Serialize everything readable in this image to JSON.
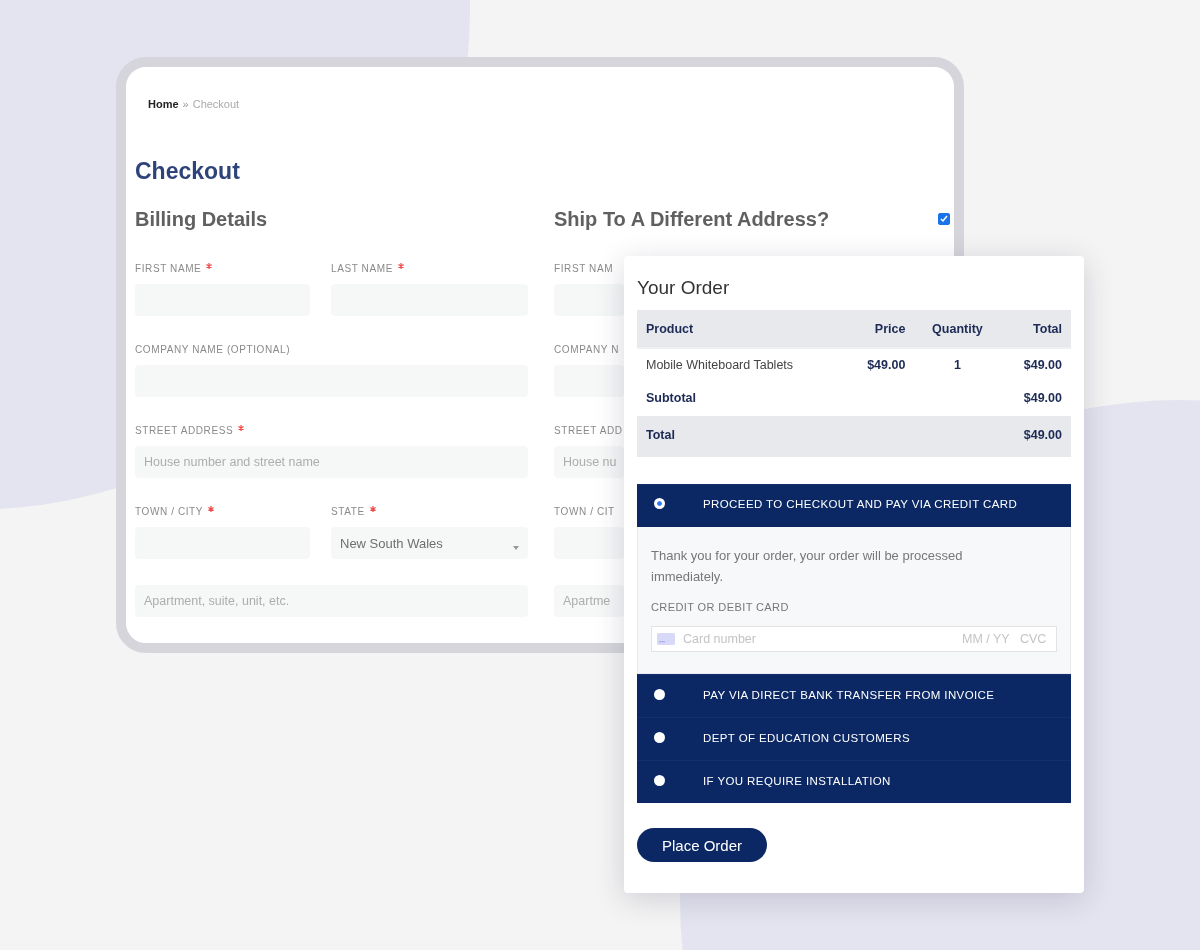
{
  "breadcrumb": {
    "items": [
      {
        "label": "Home",
        "current": false
      },
      {
        "label": "Checkout",
        "current": true
      }
    ],
    "separator": "»"
  },
  "page_title": "Checkout",
  "billing": {
    "title": "Billing Details",
    "rows": [
      {
        "fields": [
          {
            "label": "FIRST NAME",
            "required": true,
            "kind": "text"
          },
          {
            "label": "LAST NAME",
            "required": true,
            "kind": "text"
          }
        ]
      },
      {
        "fields": [
          {
            "label": "COMPANY NAME (OPTIONAL)",
            "kind": "text"
          }
        ]
      },
      {
        "fields": [
          {
            "label": "STREET ADDRESS",
            "required": true,
            "kind": "text",
            "placeholder": "House number and street name"
          }
        ]
      },
      {
        "fields": [
          {
            "label": "TOWN / CITY",
            "required": true,
            "kind": "text"
          },
          {
            "label": "STATE",
            "required": true,
            "kind": "select",
            "value": "New South Wales"
          }
        ]
      },
      {
        "fields": [
          {
            "kind": "text",
            "placeholder": "Apartment, suite, unit, etc."
          }
        ]
      }
    ]
  },
  "shipping": {
    "title": "Ship To A Different Address?",
    "checked": true,
    "rows": [
      {
        "fields": [
          {
            "label": "FIRST NAM",
            "kind": "text"
          }
        ]
      },
      {
        "fields": [
          {
            "label": "COMPANY N",
            "kind": "text"
          }
        ]
      },
      {
        "fields": [
          {
            "label": "STREET ADD",
            "kind": "text",
            "placeholder": "House nu"
          }
        ]
      },
      {
        "fields": [
          {
            "label": "TOWN / CIT",
            "kind": "text"
          }
        ]
      },
      {
        "fields": [
          {
            "kind": "text",
            "placeholder": "Apartme"
          }
        ]
      }
    ]
  },
  "order": {
    "title": "Your Order",
    "columns": [
      "Product",
      "Price",
      "Quantity",
      "Total"
    ],
    "items": [
      {
        "product": "Mobile Whiteboard Tablets",
        "price": "$49.00",
        "quantity": "1",
        "total": "$49.00"
      }
    ],
    "summary": [
      {
        "kind": "subtotal",
        "label": "Subtotal",
        "value": "$49.00"
      },
      {
        "kind": "total",
        "label": "Total",
        "value": "$49.00"
      }
    ]
  },
  "payment_methods": [
    {
      "label": "PROCEED TO CHECKOUT AND PAY VIA CREDIT CARD",
      "selected": true,
      "details": {
        "description": "Thank you for your order, your order will be processed immediately.",
        "card_label": "CREDIT OR DEBIT CARD",
        "number_placeholder": "Card number",
        "expiry_placeholder": "MM / YY",
        "cvc_placeholder": "CVC"
      }
    },
    {
      "label": "PAY VIA DIRECT BANK TRANSFER FROM INVOICE",
      "selected": false
    },
    {
      "label": "DEPT OF EDUCATION CUSTOMERS",
      "selected": false
    },
    {
      "label": "IF YOU REQUIRE INSTALLATION",
      "selected": false
    }
  ],
  "place_order": "Place Order"
}
